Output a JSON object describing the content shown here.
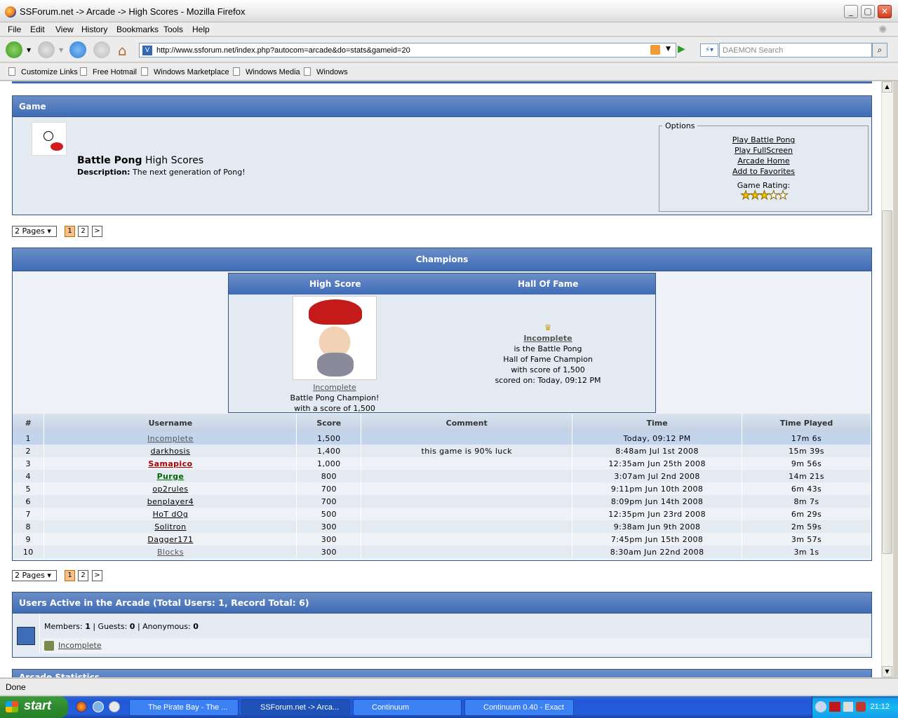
{
  "window": {
    "title": "SSForum.net -> Arcade -> High Scores - Mozilla Firefox"
  },
  "menu": [
    "File",
    "Edit",
    "View",
    "History",
    "Bookmarks",
    "Tools",
    "Help"
  ],
  "nav": {
    "url": "http://www.ssforum.net/index.php?autocom=arcade&do=stats&gameid=20",
    "search_placeholder": "DAEMON Search"
  },
  "bookmarks": [
    "Customize Links",
    "Free Hotmail",
    "Windows Marketplace",
    "Windows Media",
    "Windows"
  ],
  "game": {
    "header": "Game",
    "name": "Battle Pong",
    "title_suffix": "High Scores",
    "desc_label": "Description:",
    "description": "The next generation of Pong!",
    "options_label": "Options",
    "options": [
      "Play Battle Pong",
      "Play FullScreen",
      "Arcade Home",
      "Add to Favorites"
    ],
    "rating_label": "Game Rating:",
    "rating": 3,
    "rating_max": 5
  },
  "pager": {
    "label": "2 Pages",
    "pages": [
      "1",
      "2"
    ],
    "next": ">"
  },
  "champions": {
    "header": "Champions",
    "high_score_label": "High Score",
    "hall_label": "Hall Of Fame",
    "hs_user": "Incomplete",
    "hs_line1": "Battle Pong Champion!",
    "hs_line2": "with a score of 1,500",
    "hof_user": "Incomplete",
    "hof_line1": "is the Battle Pong",
    "hof_line2": "Hall of Fame Champion",
    "hof_line3": "with score of 1,500",
    "hof_line4": "scored on: Today, 09:12 PM"
  },
  "table": {
    "headers": [
      "#",
      "Username",
      "Score",
      "Comment",
      "Time",
      "Time Played"
    ],
    "rows": [
      {
        "n": "1",
        "user": "Incomplete",
        "score": "1,500",
        "comment": "",
        "time": "Today, 09:12 PM",
        "played": "17m 6s",
        "style": "grey"
      },
      {
        "n": "2",
        "user": "darkhosis",
        "score": "1,400",
        "comment": "this game is 90% luck",
        "time": "8:48am Jul 1st 2008",
        "played": "15m 39s",
        "style": "normal"
      },
      {
        "n": "3",
        "user": "Samapico",
        "score": "1,000",
        "comment": "",
        "time": "12:35am Jun 25th 2008",
        "played": "9m 56s",
        "style": "red"
      },
      {
        "n": "4",
        "user": "Purge",
        "score": "800",
        "comment": "",
        "time": "3:07am Jul 2nd 2008",
        "played": "14m 21s",
        "style": "green"
      },
      {
        "n": "5",
        "user": "op2rules",
        "score": "700",
        "comment": "",
        "time": "9:11pm Jun 10th 2008",
        "played": "6m 43s",
        "style": "normal"
      },
      {
        "n": "6",
        "user": "benplayer4",
        "score": "700",
        "comment": "",
        "time": "8:09pm Jun 14th 2008",
        "played": "8m 7s",
        "style": "normal"
      },
      {
        "n": "7",
        "user": "HoT dOg",
        "score": "500",
        "comment": "",
        "time": "12:35pm Jun 23rd 2008",
        "played": "6m 29s",
        "style": "normal"
      },
      {
        "n": "8",
        "user": "Solitron",
        "score": "300",
        "comment": "",
        "time": "9:38am Jun 9th 2008",
        "played": "2m 59s",
        "style": "normal"
      },
      {
        "n": "9",
        "user": "Dagger171",
        "score": "300",
        "comment": "",
        "time": "7:45pm Jun 15th 2008",
        "played": "3m 57s",
        "style": "normal"
      },
      {
        "n": "10",
        "user": "Blocks",
        "score": "300",
        "comment": "",
        "time": "8:30am Jun 22nd 2008",
        "played": "3m 1s",
        "style": "grey"
      }
    ]
  },
  "active": {
    "header": "Users Active in the Arcade (Total Users: 1, Record Total: 6)",
    "members_label": "Members:",
    "members": "1",
    "guests_label": "Guests:",
    "guests": "0",
    "anon_label": "Anonymous:",
    "anon": "0",
    "user": "Incomplete"
  },
  "next_section": "Arcade Statistics",
  "status": "Done",
  "taskbar": {
    "start": "start",
    "tasks": [
      "The Pirate Bay - The ...",
      "SSForum.net -> Arca...",
      "Continuum",
      "Continuum 0.40 - Exact"
    ],
    "clock": "21:12"
  },
  "colors": {
    "header_blue": "#3f6cb7",
    "panel": "#e4eaf2",
    "red_user": "#aa0000",
    "green_user": "#006600"
  }
}
